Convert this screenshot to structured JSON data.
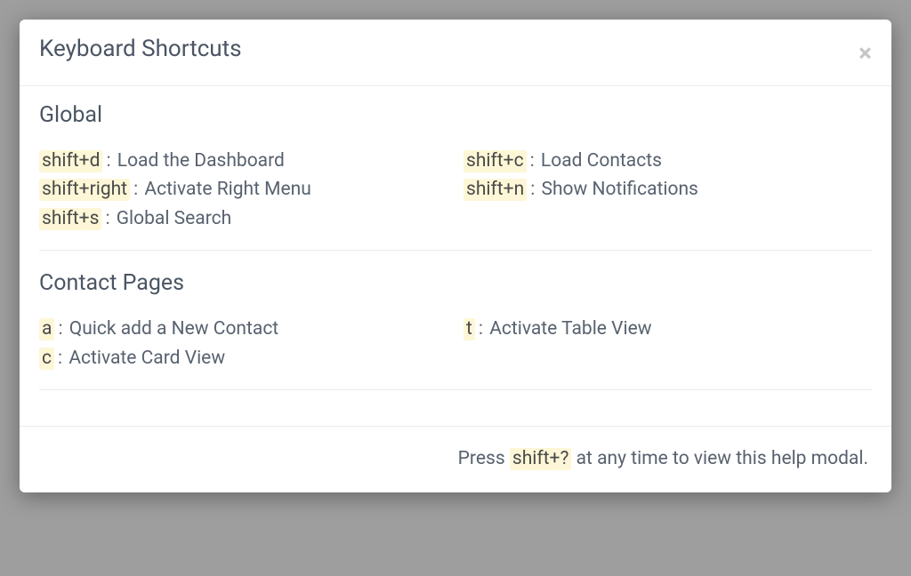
{
  "modal": {
    "title": "Keyboard Shortcuts",
    "sections": [
      {
        "heading": "Global",
        "left": [
          {
            "key": "shift+d",
            "desc": "Load the Dashboard"
          },
          {
            "key": "shift+right",
            "desc": "Activate Right Menu"
          },
          {
            "key": "shift+s",
            "desc": "Global Search"
          }
        ],
        "right": [
          {
            "key": "shift+c",
            "desc": "Load Contacts"
          },
          {
            "key": "shift+n",
            "desc": "Show Notifications"
          }
        ]
      },
      {
        "heading": "Contact Pages",
        "left": [
          {
            "key": "a",
            "desc": "Quick add a New Contact"
          },
          {
            "key": "c",
            "desc": "Activate Card View"
          }
        ],
        "right": [
          {
            "key": "t",
            "desc": "Activate Table View"
          }
        ]
      }
    ],
    "footer": {
      "prefix": "Press ",
      "key": "shift+?",
      "suffix": " at any time to view this help modal."
    }
  }
}
